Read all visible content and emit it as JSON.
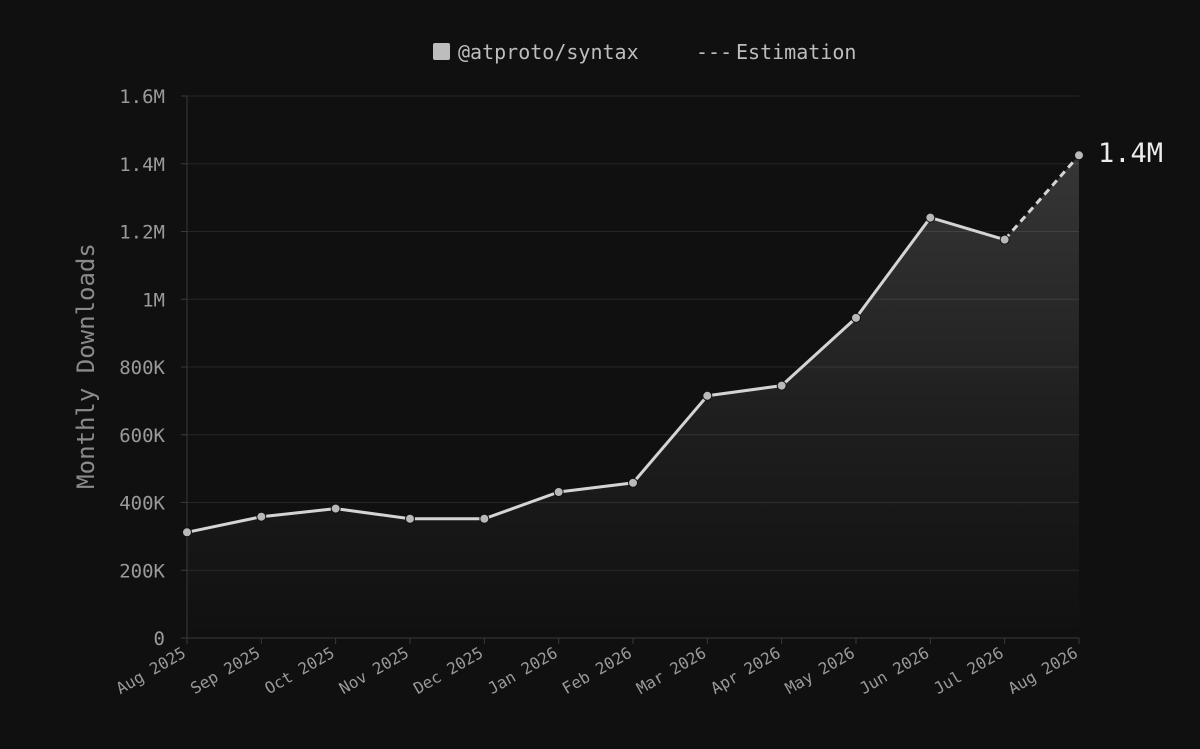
{
  "chart_data": {
    "type": "line",
    "legend": {
      "placement": "top-center",
      "series_label": "@atproto/syntax",
      "estimation_label": "Estimation",
      "estimation_glyph": "---"
    },
    "ylabel": "Monthly Downloads",
    "xlabel": "",
    "ylim": [
      0,
      1600000
    ],
    "yticks": [
      {
        "value": 0,
        "label": "0"
      },
      {
        "value": 200000,
        "label": "200K"
      },
      {
        "value": 400000,
        "label": "400K"
      },
      {
        "value": 600000,
        "label": "600K"
      },
      {
        "value": 800000,
        "label": "800K"
      },
      {
        "value": 1000000,
        "label": "1M"
      },
      {
        "value": 1200000,
        "label": "1.2M"
      },
      {
        "value": 1400000,
        "label": "1.4M"
      },
      {
        "value": 1600000,
        "label": "1.6M"
      }
    ],
    "categories": [
      "Aug 2025",
      "Sep 2025",
      "Oct 2025",
      "Nov 2025",
      "Dec 2025",
      "Jan 2026",
      "Feb 2026",
      "Mar 2026",
      "Apr 2026",
      "May 2026",
      "Jun 2026",
      "Jul 2026",
      "Aug 2026"
    ],
    "series": [
      {
        "name": "@atproto/syntax",
        "values": [
          312000,
          358000,
          382000,
          352000,
          352000,
          431000,
          458000,
          715000,
          745000,
          945000,
          1241000,
          1176000,
          1425000
        ],
        "estimated_from_index": 11
      }
    ],
    "end_label": "1.4M",
    "grid": true,
    "colors": {
      "background": "#101010",
      "line": "#d4d4d4",
      "point": "#b8b8b8",
      "grid": "#262626",
      "axis": "#3a3a3a",
      "tick_text": "#9a9a9a",
      "legend_text": "#bdbdbd",
      "end_label": "#ececec",
      "swatch": "#bdbdbd"
    }
  }
}
